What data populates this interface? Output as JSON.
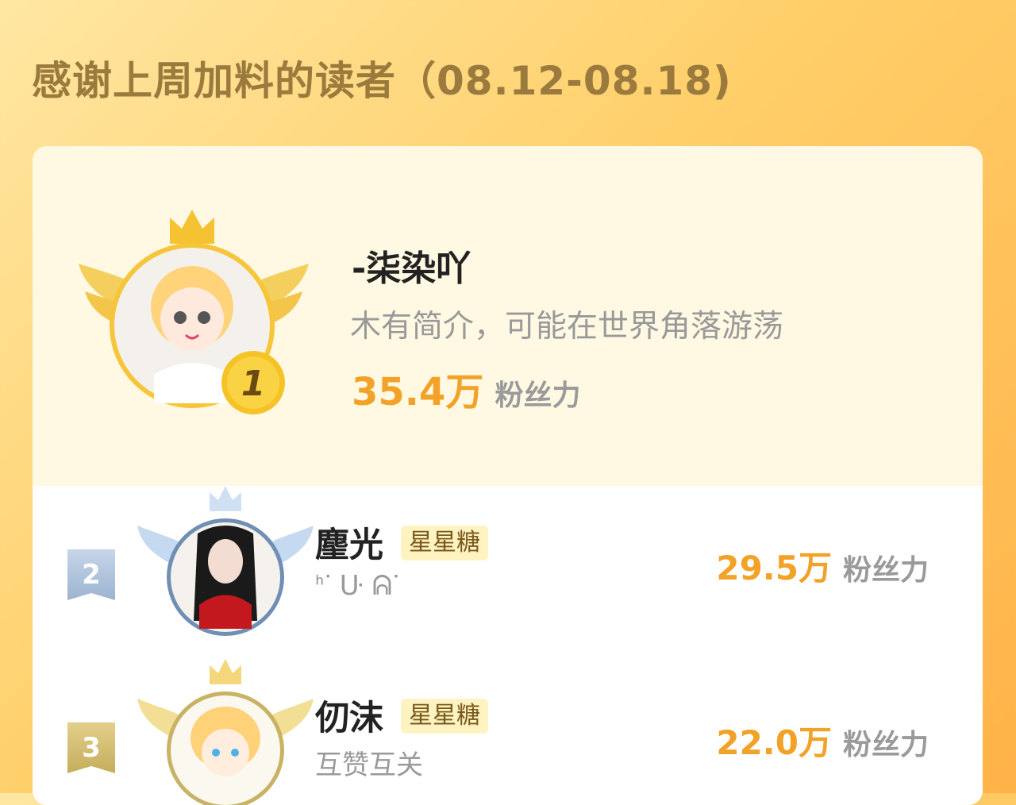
{
  "header": {
    "title": "感谢上周加料的读者（08.12-08.18)"
  },
  "first": {
    "rank": "1",
    "name": "-柒染吖",
    "bio": "木有简介，可能在世界角落游荡",
    "fans_value": "35.4万",
    "fans_unit": "粉丝力"
  },
  "rows": [
    {
      "rank": "2",
      "name": "麈光",
      "tag": "星星糖",
      "bio": "ᑋᐝ ᑘ ᕱᐝ",
      "fans_value": "29.5万",
      "fans_unit": "粉丝力"
    },
    {
      "rank": "3",
      "name": "仞沫",
      "tag": "星星糖",
      "bio": "互赞互关",
      "fans_value": "22.0万",
      "fans_unit": "粉丝力"
    }
  ],
  "colors": {
    "accent": "#f2a227",
    "title": "#9a7a3d",
    "gold": "#f4c233",
    "silver": "#a8bfdc",
    "bronze": "#c9b264"
  }
}
